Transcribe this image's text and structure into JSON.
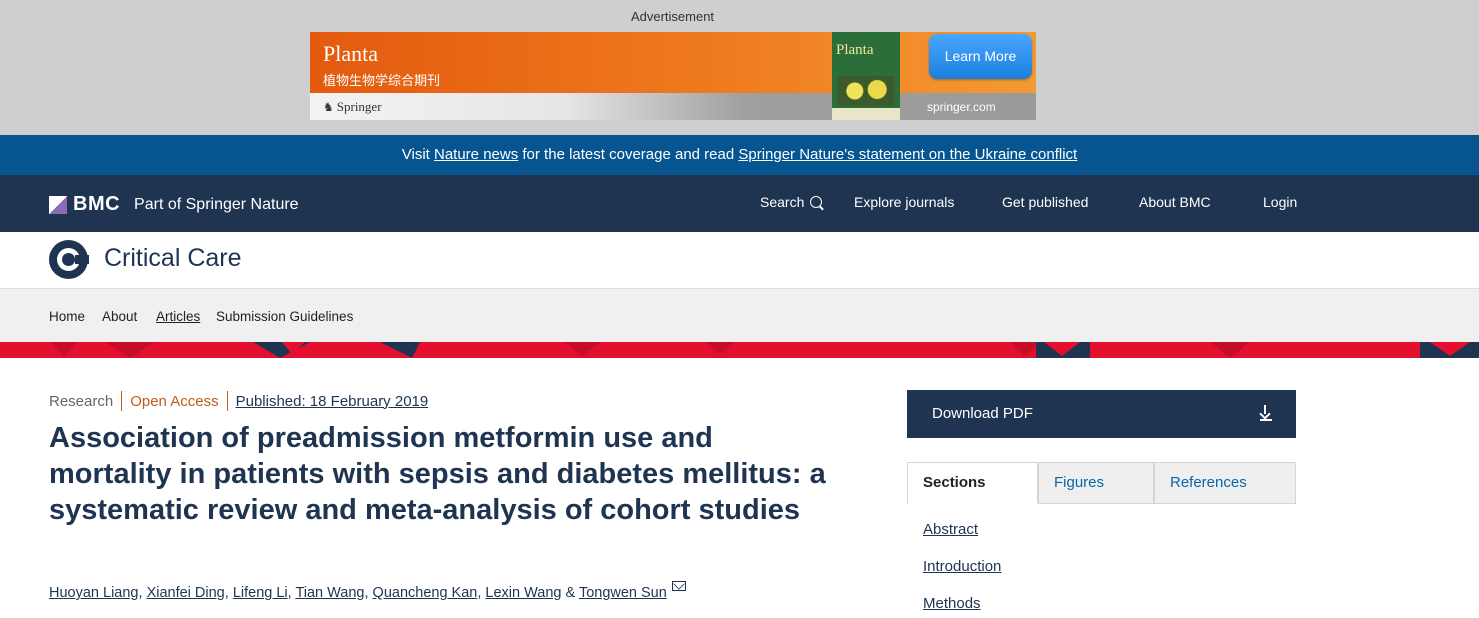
{
  "ad": {
    "label": "Advertisement",
    "title": "Planta",
    "subtitle": "植物生物学综合期刊",
    "publisher": "Springer",
    "cover_title": "Planta",
    "button": "Learn More",
    "domain": "springer.com"
  },
  "notice": {
    "prefix": "Visit ",
    "link1": "Nature news",
    "middle": " for the latest coverage and read ",
    "link2": "Springer Nature's statement on the Ukraine conflict"
  },
  "bmc": {
    "logo": "BMC",
    "tagline": "Part of Springer Nature",
    "nav": {
      "search": "Search",
      "explore": "Explore journals",
      "publish": "Get published",
      "about": "About BMC",
      "login": "Login"
    }
  },
  "journal": {
    "title": "Critical Care",
    "nav": {
      "home": "Home",
      "about": "About",
      "articles": "Articles",
      "guidelines": "Submission Guidelines"
    }
  },
  "article": {
    "type": "Research",
    "access": "Open Access",
    "published": "Published: 18 February 2019",
    "title": "Association of preadmission metformin use and mortality in patients with sepsis and diabetes mellitus: a systematic review and meta-analysis of cohort studies",
    "authors": [
      "Huoyan Liang",
      "Xianfei Ding",
      "Lifeng Li",
      "Tian Wang",
      "Quancheng Kan",
      "Lexin Wang",
      "Tongwen Sun"
    ],
    "sep_comma": ", ",
    "sep_and": " & "
  },
  "sidebar": {
    "download": "Download PDF",
    "tabs": [
      "Sections",
      "Figures",
      "References"
    ],
    "sections": [
      "Abstract",
      "Introduction",
      "Methods"
    ]
  },
  "colors": {
    "navy": "#1f3451",
    "notice_blue": "#065591",
    "band_red": "#e40f2e",
    "open_access": "#c15c1b"
  }
}
